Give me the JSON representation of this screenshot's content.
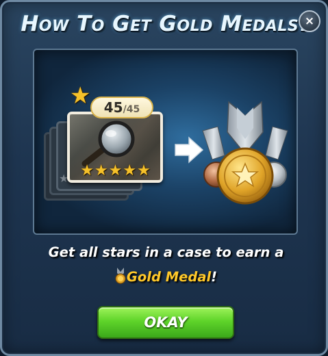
{
  "dialog": {
    "title": "How To Get Gold Medals?",
    "close_label": "×"
  },
  "illustration": {
    "score": {
      "current": "45",
      "separator": "/",
      "total": "45"
    },
    "card_stars": "★★★★★",
    "back_stars": "★★★★★",
    "arrow_icon": "right-arrow-icon",
    "medals_icon": "bronze-gold-silver-medals-icon"
  },
  "caption": {
    "line1": "Get all stars in a case to earn a",
    "medal_label": "Gold Medal",
    "suffix": "!"
  },
  "okay_button": {
    "label": "OKAY"
  },
  "colors": {
    "title": "#e8f7ff",
    "gold_text": "#ffc829",
    "button_green": "#5fd42a",
    "panel_blue": "#1e3550",
    "star_gold": "#f5c12a"
  }
}
